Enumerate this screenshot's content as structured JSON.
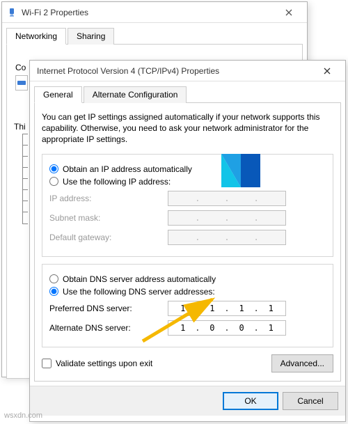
{
  "parentWindow": {
    "title": "Wi-Fi 2 Properties",
    "tabs": {
      "networking": "Networking",
      "sharing": "Sharing"
    },
    "connectLabel": "Co",
    "thLabel": "Thi"
  },
  "dialog": {
    "title": "Internet Protocol Version 4 (TCP/IPv4) Properties",
    "tabs": {
      "general": "General",
      "alternate": "Alternate Configuration"
    },
    "description": "You can get IP settings assigned automatically if your network supports this capability. Otherwise, you need to ask your network administrator for the appropriate IP settings.",
    "ipSection": {
      "auto": "Obtain an IP address automatically",
      "manual": "Use the following IP address:",
      "selected": "auto",
      "fields": {
        "ipAddress": {
          "label": "IP address:",
          "value": [
            "",
            "",
            "",
            ""
          ]
        },
        "subnetMask": {
          "label": "Subnet mask:",
          "value": [
            "",
            "",
            "",
            ""
          ]
        },
        "defaultGateway": {
          "label": "Default gateway:",
          "value": [
            "",
            "",
            "",
            ""
          ]
        }
      }
    },
    "dnsSection": {
      "auto": "Obtain DNS server address automatically",
      "manual": "Use the following DNS server addresses:",
      "selected": "manual",
      "fields": {
        "preferred": {
          "label": "Preferred DNS server:",
          "value": [
            "1",
            "1",
            "1",
            "1"
          ]
        },
        "alternate": {
          "label": "Alternate DNS server:",
          "value": [
            "1",
            "0",
            "0",
            "1"
          ]
        }
      }
    },
    "validateOnExit": {
      "label": "Validate settings upon exit",
      "checked": false
    },
    "advancedButton": "Advanced...",
    "ok": "OK",
    "cancel": "Cancel"
  },
  "watermark": "wsxdn.com"
}
